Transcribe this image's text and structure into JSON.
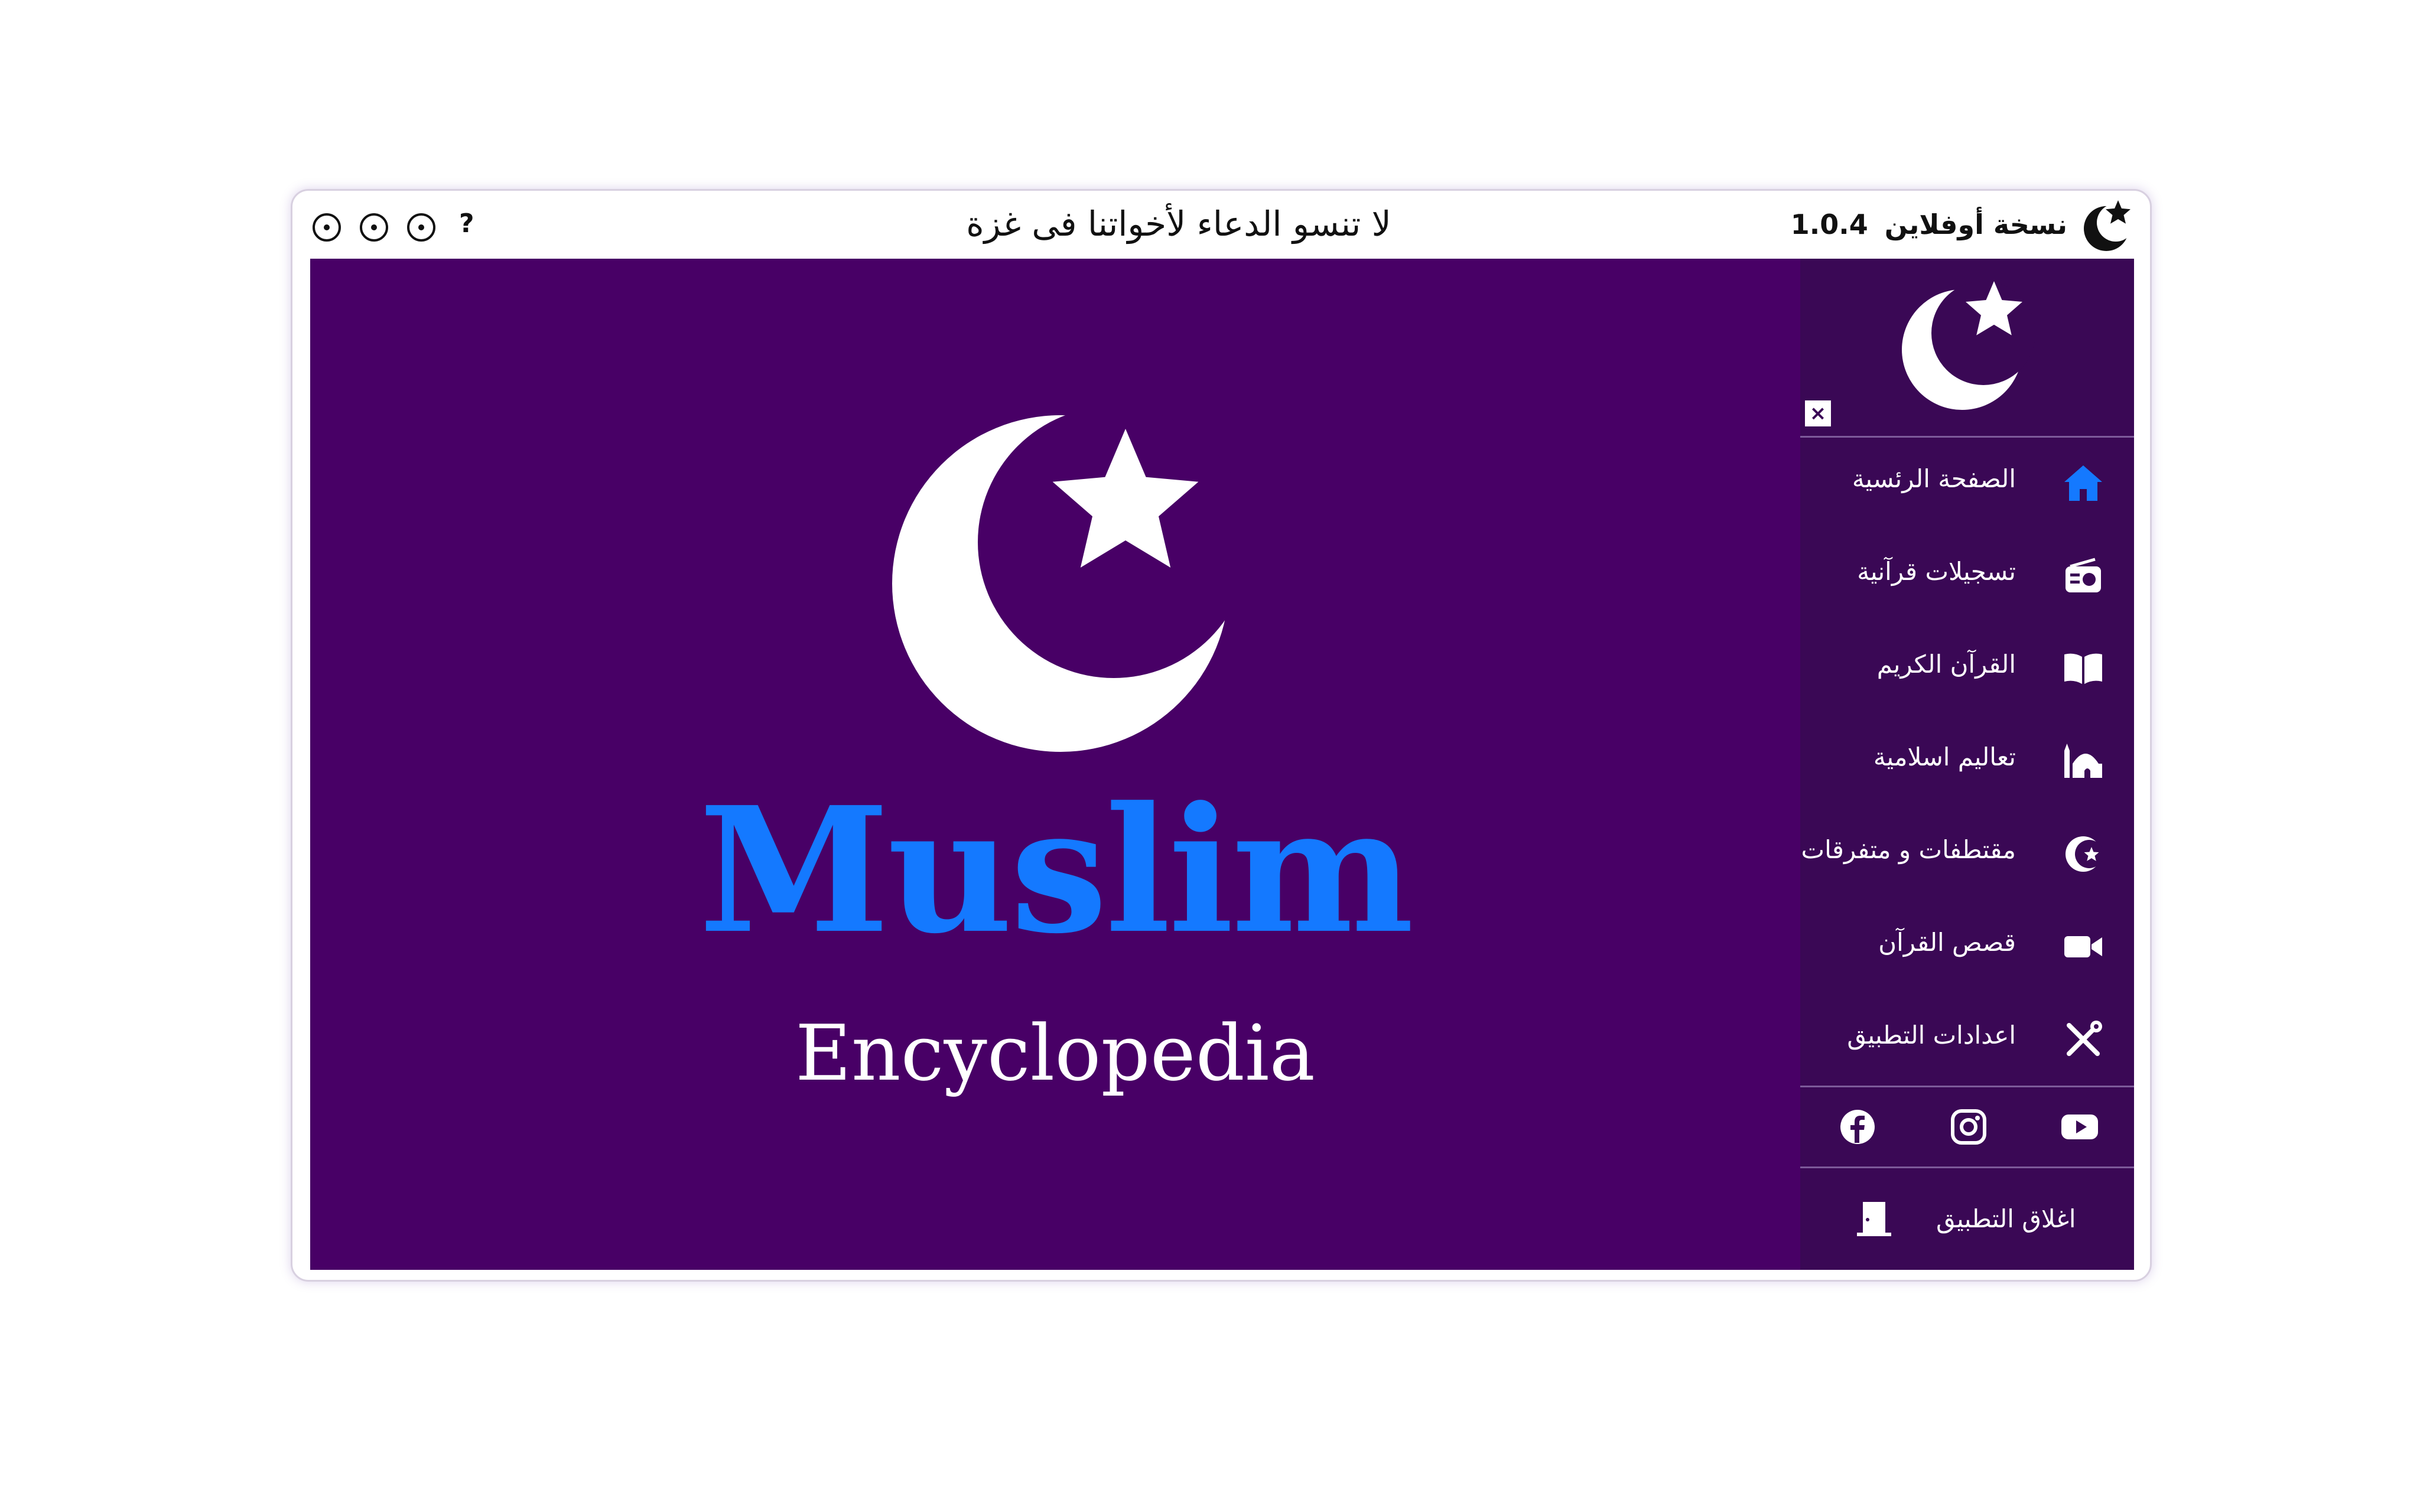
{
  "titlebar": {
    "center_text": "لا تنسو الدعاء لأخواتنا فى غزة",
    "version_label": "نسخة أوفلاين",
    "version_number": "1.0.4",
    "help_label": "?"
  },
  "hero": {
    "title": "Muslim",
    "subtitle": "Encyclopedia"
  },
  "sidebar": {
    "close_label": "×",
    "items": [
      {
        "label": "الصفحة الرئسية",
        "icon": "home-icon",
        "active": true
      },
      {
        "label": "تسجيلات قرآنية",
        "icon": "radio-icon"
      },
      {
        "label": "القرآن الكريم",
        "icon": "book-open-icon"
      },
      {
        "label": "تعاليم اسلامية",
        "icon": "mosque-icon"
      },
      {
        "label": "مقتطفات و متفرقات",
        "icon": "star-and-crescent-icon"
      },
      {
        "label": "قصص القرآن",
        "icon": "video-camera-icon"
      },
      {
        "label": "اعدادات التطبيق",
        "icon": "tools-icon"
      }
    ],
    "social": [
      "facebook-icon",
      "instagram-icon",
      "youtube-icon"
    ],
    "exit_label": "اغلاق التطبيق"
  },
  "colors": {
    "main_bg": "#480066",
    "sidebar_bg": "#3a0855",
    "accent_blue": "#1479ff",
    "white": "#ffffff"
  }
}
